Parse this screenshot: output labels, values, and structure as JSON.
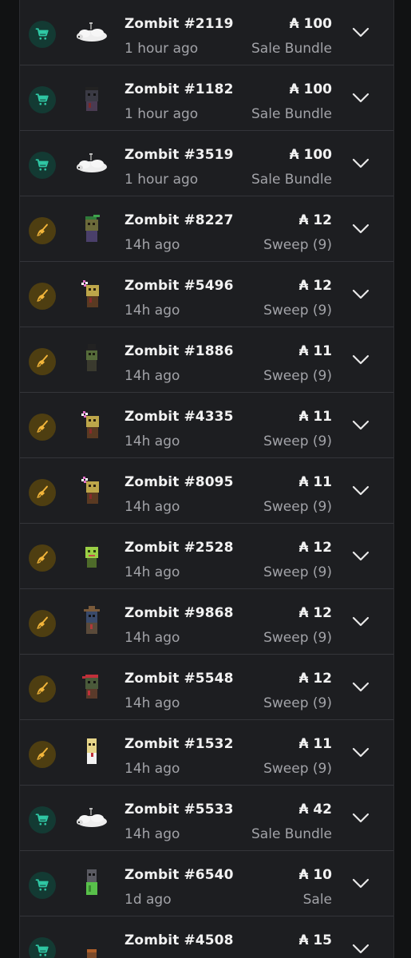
{
  "currency_symbol": "₳",
  "colors": {
    "sale_badge_bg": "#133a33",
    "sale_icon": "#2fc7a4",
    "sweep_badge_bg": "#4e3e11",
    "sweep_icon": "#f2b53a"
  },
  "activity": [
    {
      "kind": "sale",
      "icon": "cart-icon",
      "name": "Zombit #2119",
      "time": "1 hour ago",
      "price": "₳ 100",
      "type": "Sale Bundle",
      "art": "sheep"
    },
    {
      "kind": "sale",
      "icon": "cart-icon",
      "name": "Zombit #1182",
      "time": "1 hour ago",
      "price": "₳ 100",
      "type": "Sale Bundle",
      "art": "dark-zombie"
    },
    {
      "kind": "sale",
      "icon": "cart-icon",
      "name": "Zombit #3519",
      "time": "1 hour ago",
      "price": "₳ 100",
      "type": "Sale Bundle",
      "art": "sheep"
    },
    {
      "kind": "sweep",
      "icon": "broom-icon",
      "name": "Zombit #8227",
      "time": "14h ago",
      "price": "₳ 12",
      "type": "Sweep (9)",
      "art": "green-hat-zombie"
    },
    {
      "kind": "sweep",
      "icon": "broom-icon",
      "name": "Zombit #5496",
      "time": "14h ago",
      "price": "₳ 12",
      "type": "Sweep (9)",
      "art": "flower-zombie"
    },
    {
      "kind": "sweep",
      "icon": "broom-icon",
      "name": "Zombit #1886",
      "time": "14h ago",
      "price": "₳ 11",
      "type": "Sweep (9)",
      "art": "tophat-zombie"
    },
    {
      "kind": "sweep",
      "icon": "broom-icon",
      "name": "Zombit #4335",
      "time": "14h ago",
      "price": "₳ 11",
      "type": "Sweep (9)",
      "art": "flower-zombie"
    },
    {
      "kind": "sweep",
      "icon": "broom-icon",
      "name": "Zombit #8095",
      "time": "14h ago",
      "price": "₳ 11",
      "type": "Sweep (9)",
      "art": "flower-zombie"
    },
    {
      "kind": "sweep",
      "icon": "broom-icon",
      "name": "Zombit #2528",
      "time": "14h ago",
      "price": "₳ 12",
      "type": "Sweep (9)",
      "art": "lime-tophat-zombie"
    },
    {
      "kind": "sweep",
      "icon": "broom-icon",
      "name": "Zombit #9868",
      "time": "14h ago",
      "price": "₳ 12",
      "type": "Sweep (9)",
      "art": "witch-zombie"
    },
    {
      "kind": "sweep",
      "icon": "broom-icon",
      "name": "Zombit #5548",
      "time": "14h ago",
      "price": "₳ 12",
      "type": "Sweep (9)",
      "art": "bandana-zombie"
    },
    {
      "kind": "sweep",
      "icon": "broom-icon",
      "name": "Zombit #1532",
      "time": "14h ago",
      "price": "₳ 11",
      "type": "Sweep (9)",
      "art": "pale-zombie"
    },
    {
      "kind": "sale",
      "icon": "cart-icon",
      "name": "Zombit #5533",
      "time": "14h ago",
      "price": "₳ 42",
      "type": "Sale Bundle",
      "art": "sheep"
    },
    {
      "kind": "sale",
      "icon": "cart-icon",
      "name": "Zombit #6540",
      "time": "1d ago",
      "price": "₳ 10",
      "type": "Sale",
      "art": "green-zombie"
    },
    {
      "kind": "sale",
      "icon": "cart-icon",
      "name": "Zombit #4508",
      "time": "",
      "price": "₳ 15",
      "type": "",
      "art": "brown-zombie"
    }
  ]
}
